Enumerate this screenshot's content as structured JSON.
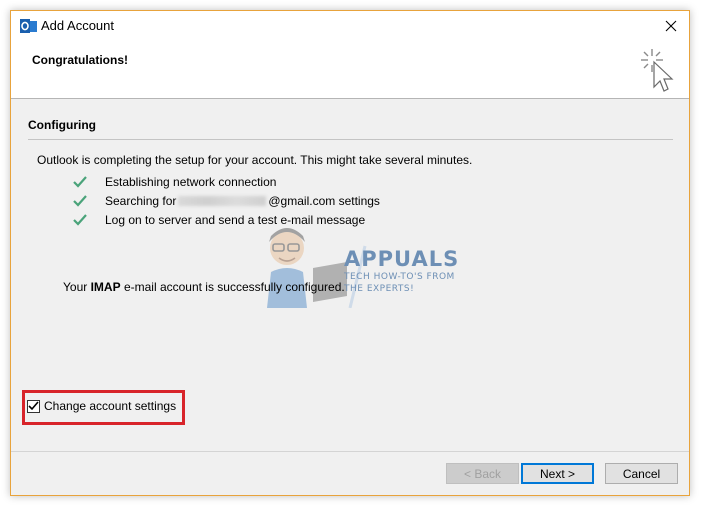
{
  "window": {
    "title": "Add Account",
    "accent_border": "#e8a33c"
  },
  "header": {
    "title": "Congratulations!"
  },
  "configuring": {
    "section_title": "Configuring",
    "intro": "Outlook is completing the setup for your account. This might take several minutes.",
    "tasks": [
      {
        "label": "Establishing network connection",
        "status": "done"
      },
      {
        "prefix": "Searching for",
        "suffix": "@gmail.com settings",
        "status": "done"
      },
      {
        "label": "Log on to server and send a test e-mail message",
        "status": "done"
      }
    ]
  },
  "result": {
    "prefix": "Your",
    "bold": "IMAP",
    "suffix": "e-mail account is successfully configured."
  },
  "watermark": {
    "brand": "APPUALS",
    "tagline_1": "TECH HOW-TO'S FROM",
    "tagline_2": "THE EXPERTS!"
  },
  "options": {
    "change_settings_label": "Change account settings",
    "change_settings_checked": true,
    "highlight_color": "#d8242a"
  },
  "buttons": {
    "back": "< Back",
    "next": "Next >",
    "cancel": "Cancel"
  },
  "icons": {
    "app": "outlook-icon",
    "close": "close-icon",
    "wizard": "wizard-cursor-icon",
    "task_done": "checkmark-icon"
  },
  "colors": {
    "check_green": "#4aa37a",
    "primary_button_border": "#0078d7"
  }
}
